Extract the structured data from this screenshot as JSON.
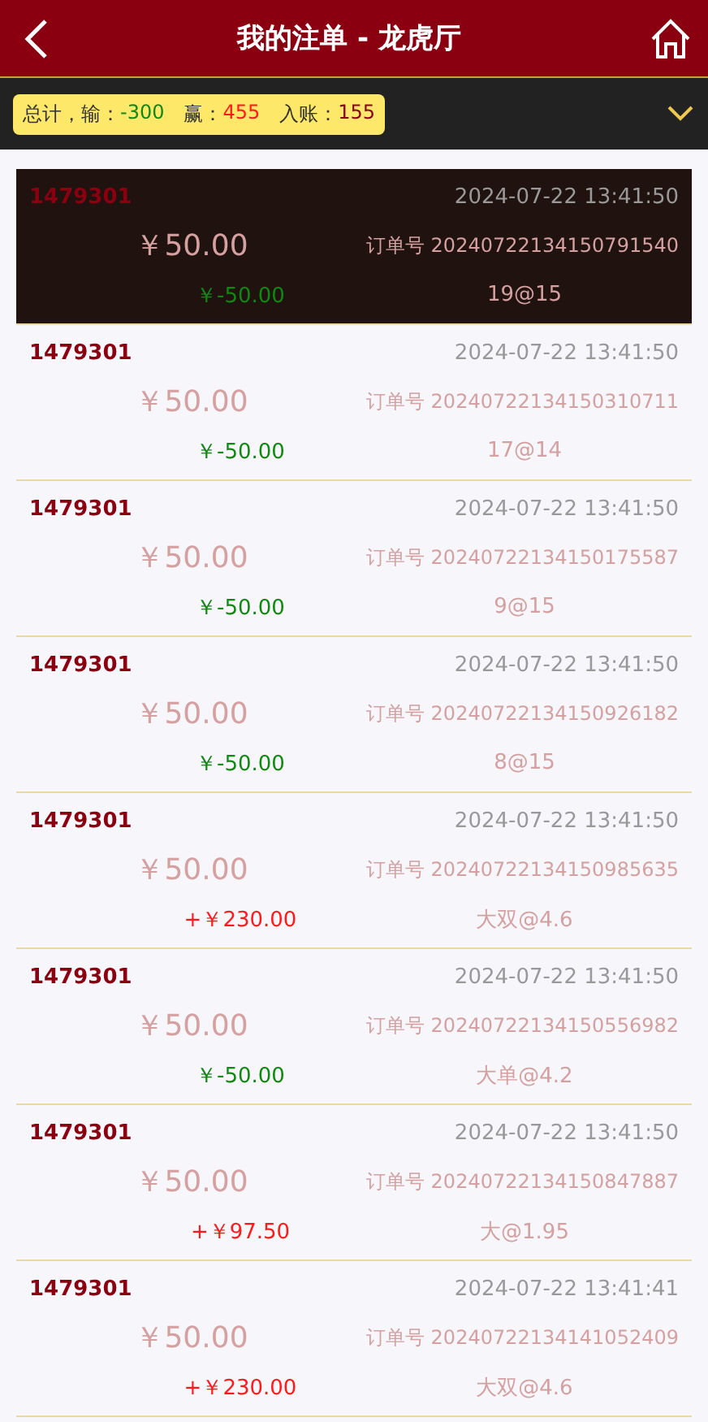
{
  "header": {
    "title": "我的注单 - 龙虎厅"
  },
  "summary": {
    "total_label": "总计，",
    "lose_label": "输：",
    "lose_value": "-300",
    "win_label": "赢：",
    "win_value": "455",
    "income_label": "入账：",
    "income_value": "155"
  },
  "bets": [
    {
      "user": "1479301",
      "time": "2024-07-22 13:41:50",
      "amount": "￥50.00",
      "order": "订单号 20240722134150791540",
      "result": "￥-50.00",
      "kind": "lose",
      "pick": "19@15",
      "selected": true
    },
    {
      "user": "1479301",
      "time": "2024-07-22 13:41:50",
      "amount": "￥50.00",
      "order": "订单号 20240722134150310711",
      "result": "￥-50.00",
      "kind": "lose",
      "pick": "17@14",
      "selected": false
    },
    {
      "user": "1479301",
      "time": "2024-07-22 13:41:50",
      "amount": "￥50.00",
      "order": "订单号 20240722134150175587",
      "result": "￥-50.00",
      "kind": "lose",
      "pick": "9@15",
      "selected": false
    },
    {
      "user": "1479301",
      "time": "2024-07-22 13:41:50",
      "amount": "￥50.00",
      "order": "订单号 20240722134150926182",
      "result": "￥-50.00",
      "kind": "lose",
      "pick": "8@15",
      "selected": false
    },
    {
      "user": "1479301",
      "time": "2024-07-22 13:41:50",
      "amount": "￥50.00",
      "order": "订单号 20240722134150985635",
      "result": "+￥230.00",
      "kind": "win",
      "pick": "大双@4.6",
      "selected": false
    },
    {
      "user": "1479301",
      "time": "2024-07-22 13:41:50",
      "amount": "￥50.00",
      "order": "订单号 20240722134150556982",
      "result": "￥-50.00",
      "kind": "lose",
      "pick": "大单@4.2",
      "selected": false
    },
    {
      "user": "1479301",
      "time": "2024-07-22 13:41:50",
      "amount": "￥50.00",
      "order": "订单号 20240722134150847887",
      "result": "+￥97.50",
      "kind": "win",
      "pick": "大@1.95",
      "selected": false
    },
    {
      "user": "1479301",
      "time": "2024-07-22 13:41:41",
      "amount": "￥50.00",
      "order": "订单号 20240722134141052409",
      "result": "+￥230.00",
      "kind": "win",
      "pick": "大双@4.6",
      "selected": false
    }
  ]
}
